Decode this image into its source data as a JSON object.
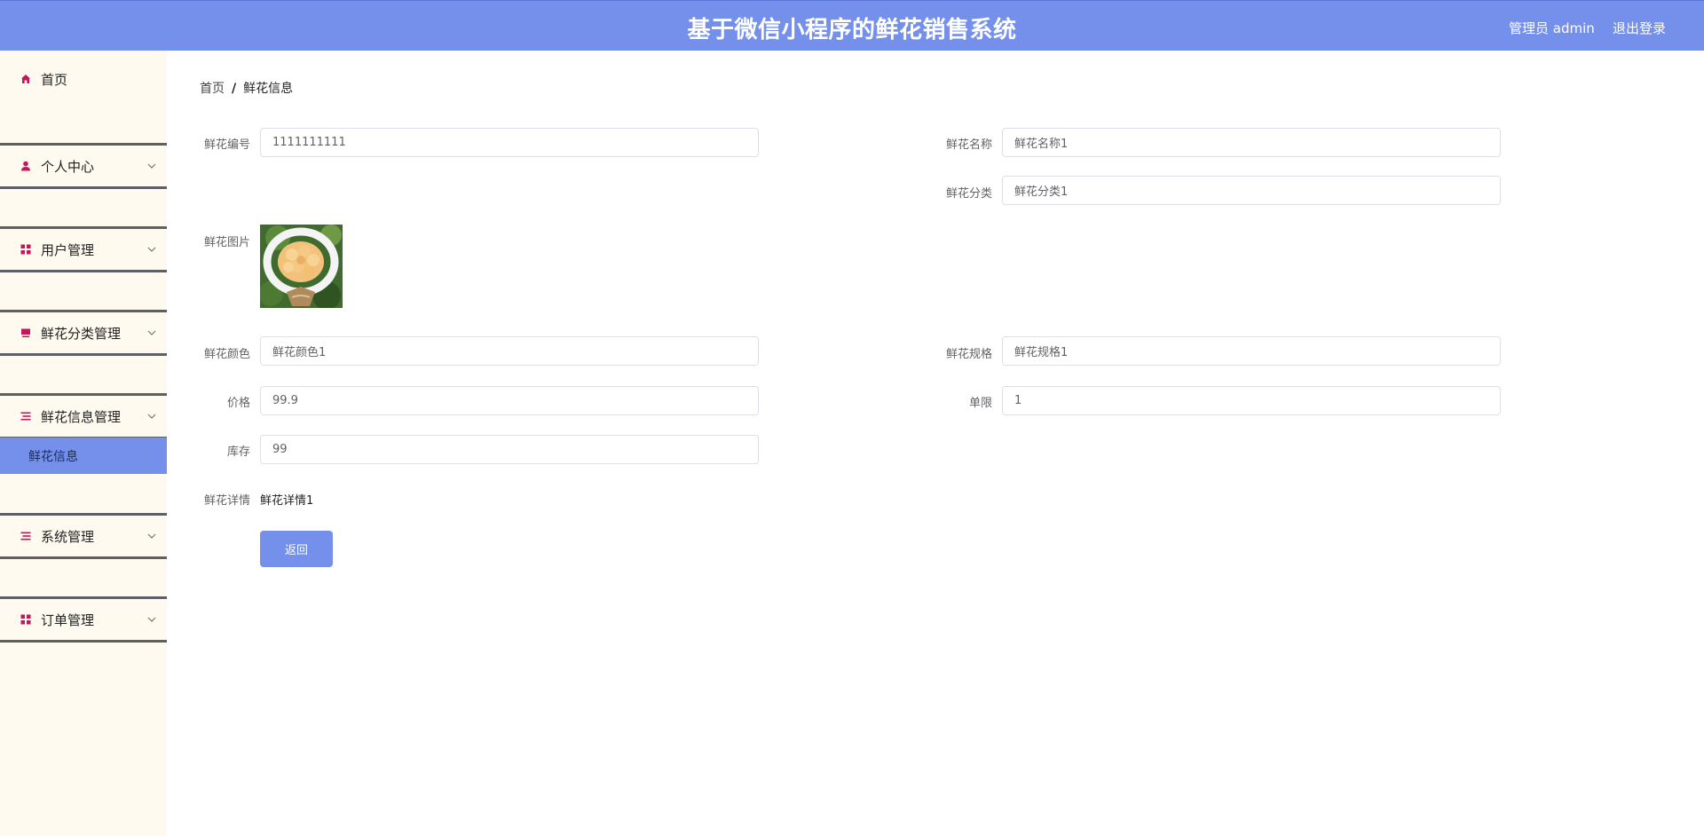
{
  "header": {
    "title": "基于微信小程序的鲜花销售系统",
    "user": "管理员 admin",
    "logout": "退出登录"
  },
  "sidebar": {
    "items": [
      {
        "label": "首页",
        "icon": "home-icon"
      },
      {
        "label": "个人中心",
        "icon": "user-icon"
      },
      {
        "label": "用户管理",
        "icon": "grid-icon"
      },
      {
        "label": "鲜花分类管理",
        "icon": "box-icon"
      },
      {
        "label": "鲜花信息管理",
        "icon": "list-icon"
      },
      {
        "label": "系统管理",
        "icon": "list-icon"
      },
      {
        "label": "订单管理",
        "icon": "grid-icon"
      }
    ],
    "active_sub": "鲜花信息"
  },
  "breadcrumb": {
    "home": "首页",
    "sep": "/",
    "current": "鲜花信息"
  },
  "form": {
    "code": {
      "label": "鲜花编号",
      "value": "1111111111"
    },
    "name": {
      "label": "鲜花名称",
      "value": "鲜花名称1"
    },
    "category": {
      "label": "鲜花分类",
      "value": "鲜花分类1"
    },
    "image": {
      "label": "鲜花图片"
    },
    "color": {
      "label": "鲜花颜色",
      "value": "鲜花颜色1"
    },
    "spec": {
      "label": "鲜花规格",
      "value": "鲜花规格1"
    },
    "price": {
      "label": "价格",
      "value": "99.9"
    },
    "limit": {
      "label": "单限",
      "value": "1"
    },
    "stock": {
      "label": "库存",
      "value": "99"
    },
    "detail": {
      "label": "鲜花详情",
      "value": "鲜花详情1"
    }
  },
  "buttons": {
    "back": "返回"
  },
  "colors": {
    "accent": "#7590eb",
    "sidebar_bg": "#fffaef",
    "icon": "#c2185b"
  }
}
